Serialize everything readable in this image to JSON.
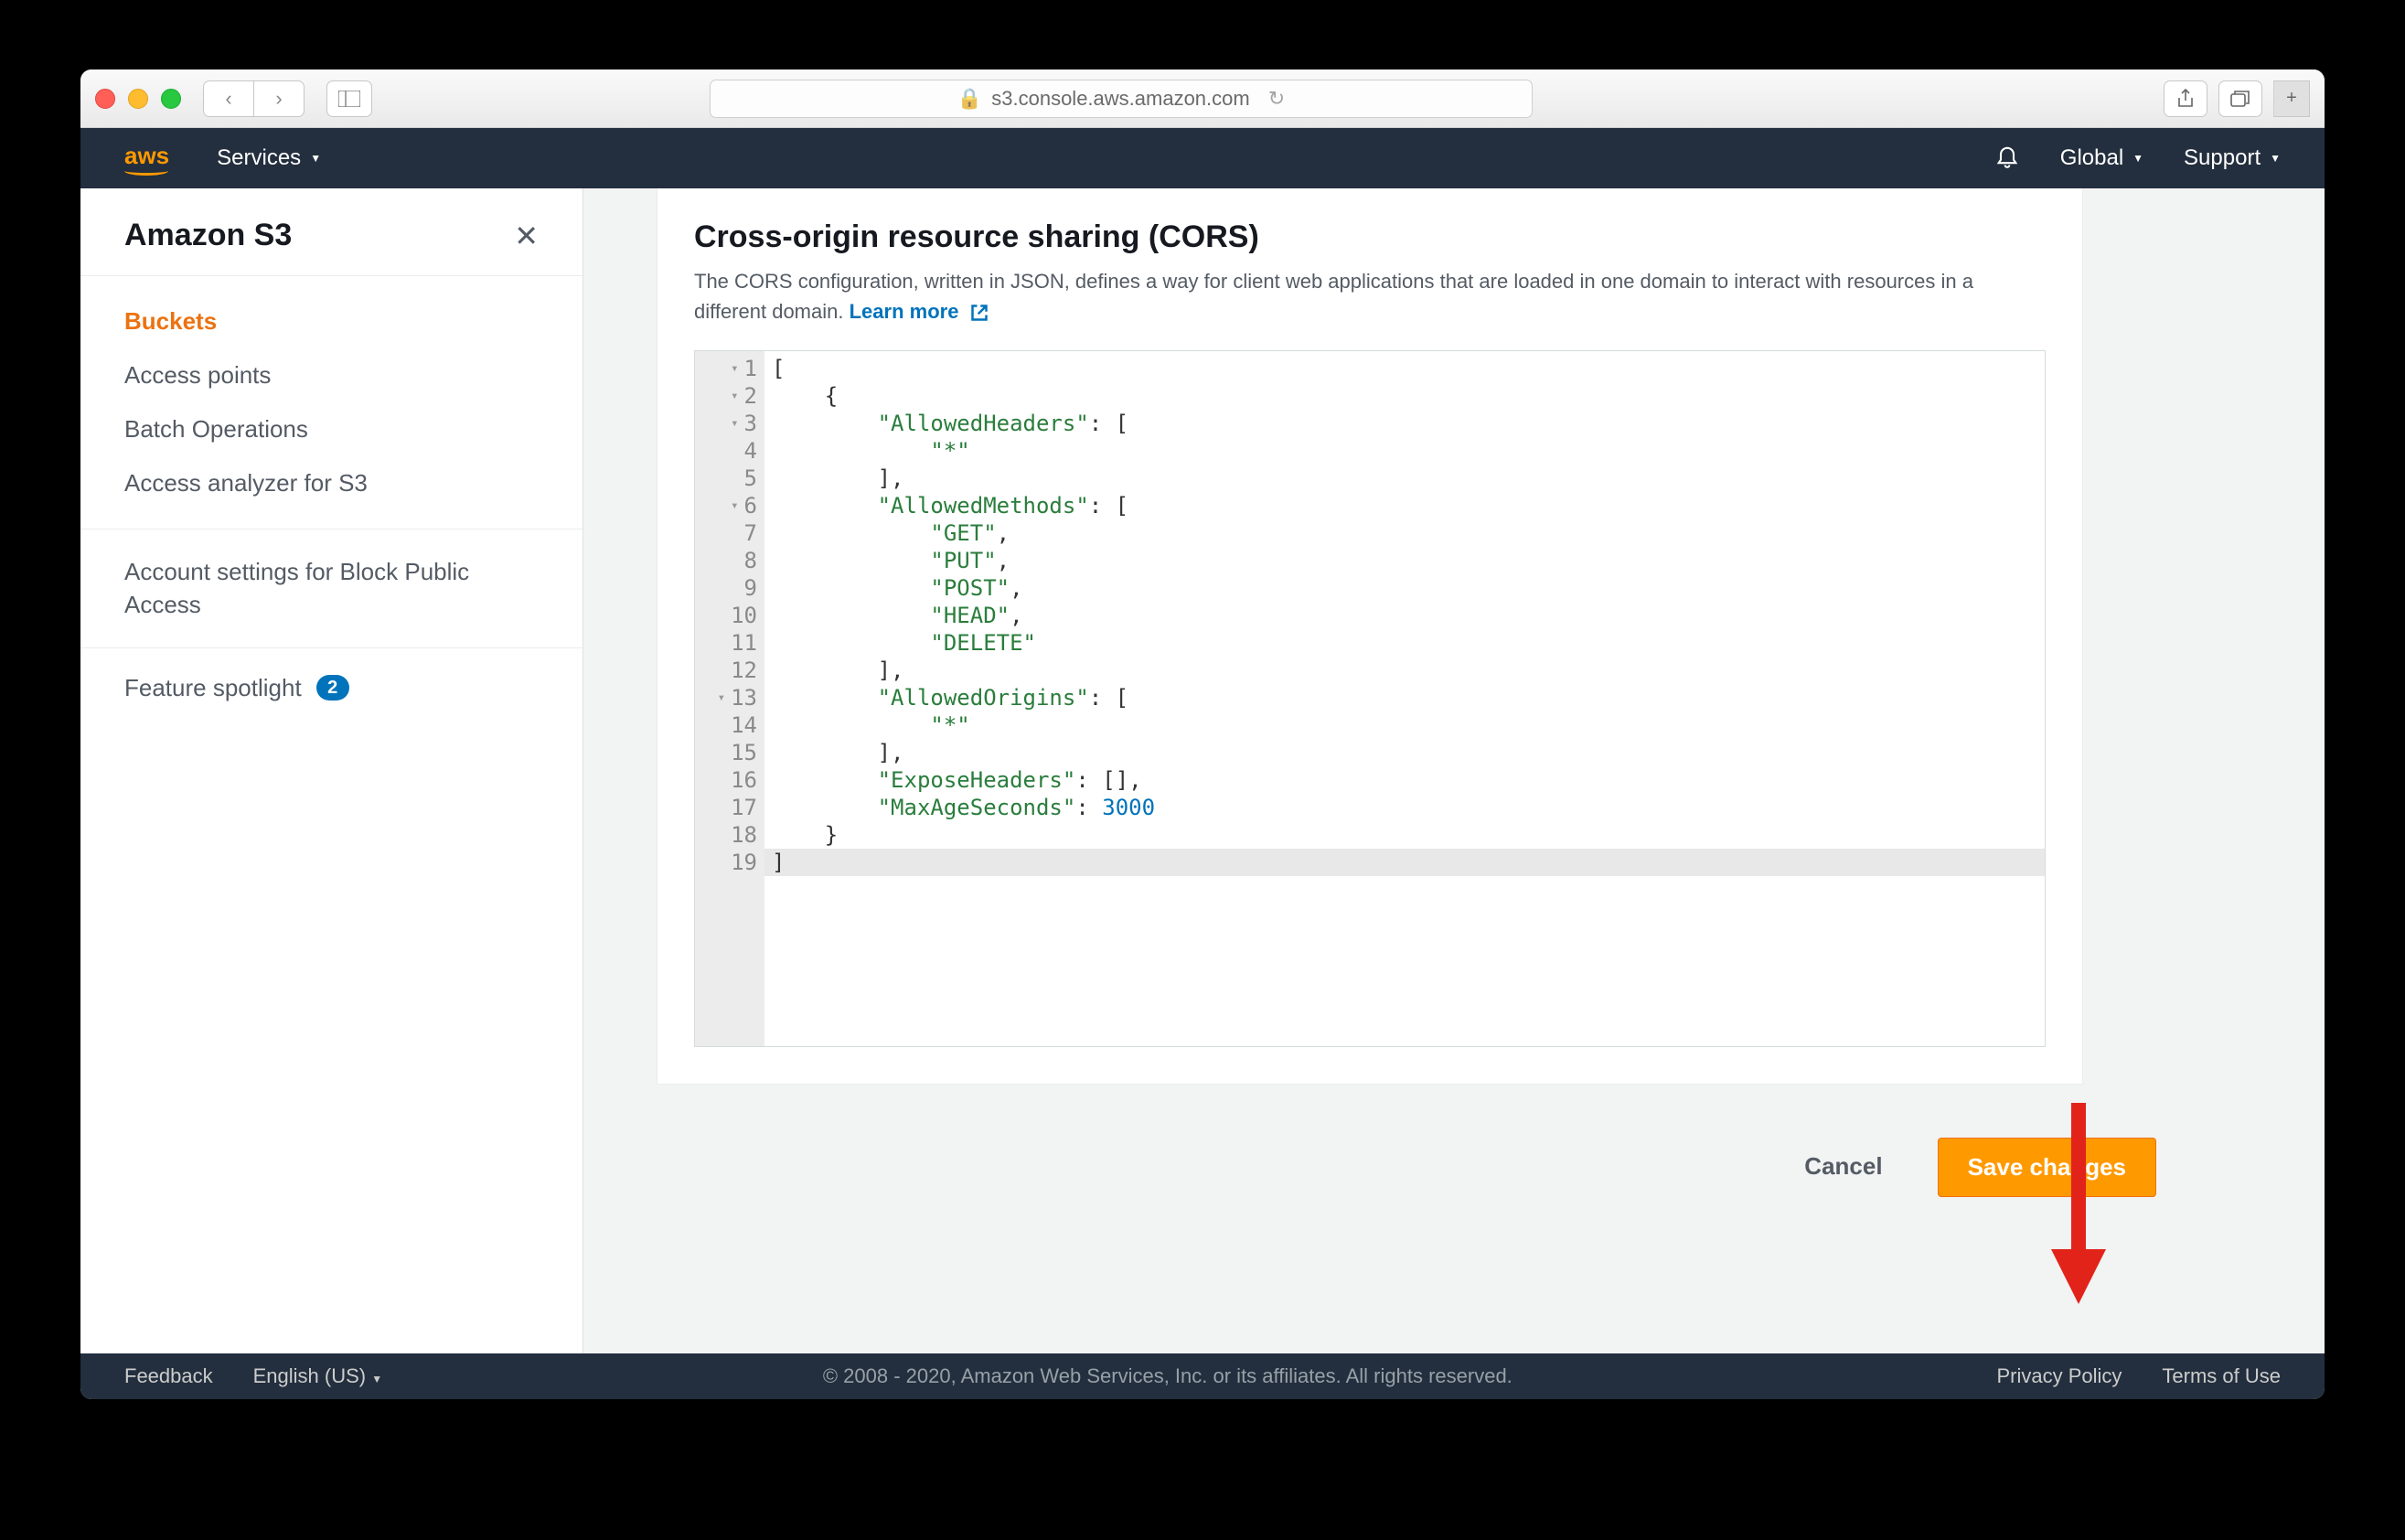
{
  "browser": {
    "url": "s3.console.aws.amazon.com"
  },
  "header": {
    "logo": "aws",
    "services": "Services",
    "global": "Global",
    "support": "Support"
  },
  "sidebar": {
    "title": "Amazon S3",
    "items": [
      {
        "label": "Buckets",
        "active": true
      },
      {
        "label": "Access points"
      },
      {
        "label": "Batch Operations"
      },
      {
        "label": "Access analyzer for S3"
      }
    ],
    "account_settings": "Account settings for Block Public Access",
    "feature_spotlight": "Feature spotlight",
    "spotlight_count": "2"
  },
  "panel": {
    "title": "Cross-origin resource sharing (CORS)",
    "description": "The CORS configuration, written in JSON, defines a way for client web applications that are loaded in one domain to interact with resources in a different domain.",
    "learn_more": "Learn more"
  },
  "editor": {
    "lines": [
      {
        "n": 1,
        "fold": true,
        "indent": 0,
        "tokens": [
          [
            "p",
            "["
          ]
        ]
      },
      {
        "n": 2,
        "fold": true,
        "indent": 1,
        "tokens": [
          [
            "p",
            "{"
          ]
        ]
      },
      {
        "n": 3,
        "fold": true,
        "indent": 2,
        "tokens": [
          [
            "k",
            "\"AllowedHeaders\""
          ],
          [
            "p",
            ": ["
          ]
        ]
      },
      {
        "n": 4,
        "indent": 3,
        "tokens": [
          [
            "s",
            "\"*\""
          ]
        ]
      },
      {
        "n": 5,
        "indent": 2,
        "tokens": [
          [
            "p",
            "],"
          ]
        ]
      },
      {
        "n": 6,
        "fold": true,
        "indent": 2,
        "tokens": [
          [
            "k",
            "\"AllowedMethods\""
          ],
          [
            "p",
            ": ["
          ]
        ]
      },
      {
        "n": 7,
        "indent": 3,
        "tokens": [
          [
            "s",
            "\"GET\""
          ],
          [
            "p",
            ","
          ]
        ]
      },
      {
        "n": 8,
        "indent": 3,
        "tokens": [
          [
            "s",
            "\"PUT\""
          ],
          [
            "p",
            ","
          ]
        ]
      },
      {
        "n": 9,
        "indent": 3,
        "tokens": [
          [
            "s",
            "\"POST\""
          ],
          [
            "p",
            ","
          ]
        ]
      },
      {
        "n": 10,
        "indent": 3,
        "tokens": [
          [
            "s",
            "\"HEAD\""
          ],
          [
            "p",
            ","
          ]
        ]
      },
      {
        "n": 11,
        "indent": 3,
        "tokens": [
          [
            "s",
            "\"DELETE\""
          ]
        ]
      },
      {
        "n": 12,
        "indent": 2,
        "tokens": [
          [
            "p",
            "],"
          ]
        ]
      },
      {
        "n": 13,
        "fold": true,
        "indent": 2,
        "tokens": [
          [
            "k",
            "\"AllowedOrigins\""
          ],
          [
            "p",
            ": ["
          ]
        ]
      },
      {
        "n": 14,
        "indent": 3,
        "tokens": [
          [
            "s",
            "\"*\""
          ]
        ]
      },
      {
        "n": 15,
        "indent": 2,
        "tokens": [
          [
            "p",
            "],"
          ]
        ]
      },
      {
        "n": 16,
        "indent": 2,
        "tokens": [
          [
            "k",
            "\"ExposeHeaders\""
          ],
          [
            "p",
            ": [],"
          ]
        ]
      },
      {
        "n": 17,
        "indent": 2,
        "tokens": [
          [
            "k",
            "\"MaxAgeSeconds\""
          ],
          [
            "p",
            ": "
          ],
          [
            "n",
            "3000"
          ]
        ]
      },
      {
        "n": 18,
        "indent": 1,
        "tokens": [
          [
            "p",
            "}"
          ]
        ]
      },
      {
        "n": 19,
        "indent": 0,
        "current": true,
        "tokens": [
          [
            "p",
            "]"
          ]
        ]
      }
    ]
  },
  "actions": {
    "cancel": "Cancel",
    "save": "Save changes"
  },
  "footer": {
    "feedback": "Feedback",
    "language": "English (US)",
    "copyright": "© 2008 - 2020, Amazon Web Services, Inc. or its affiliates. All rights reserved.",
    "privacy": "Privacy Policy",
    "terms": "Terms of Use"
  }
}
